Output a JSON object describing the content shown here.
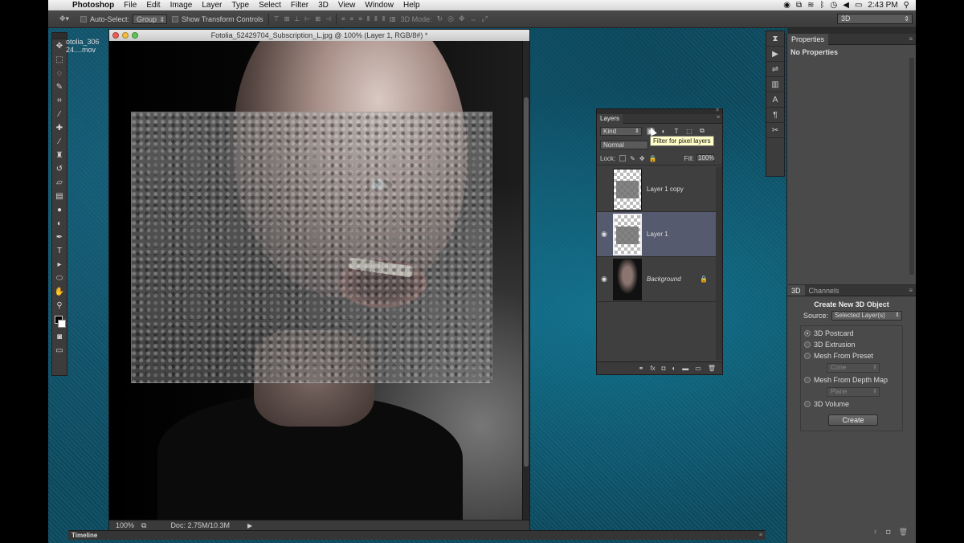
{
  "menubar": {
    "app_name": "Photoshop",
    "items": [
      "File",
      "Edit",
      "Image",
      "Layer",
      "Type",
      "Select",
      "Filter",
      "3D",
      "View",
      "Window",
      "Help"
    ],
    "clock": "2:43 PM"
  },
  "options_bar": {
    "auto_select_label": "Auto-Select:",
    "auto_select_value": "Group",
    "transform_label": "Show Transform Controls",
    "mode_3d_label": "3D Mode:",
    "workspace": "3D"
  },
  "doc_stub": {
    "line1": "otolia_306",
    "line2": "24....mov"
  },
  "document": {
    "title": "Fotolia_52429704_Subscription_L.jpg @ 100% (Layer 1, RGB/8#) *",
    "zoom": "100%",
    "doc_size": "Doc: 2.75M/10.3M"
  },
  "properties_panel": {
    "tab": "Properties",
    "empty_text": "No Properties"
  },
  "panel_3d": {
    "tabs": [
      "3D",
      "Channels"
    ],
    "heading": "Create New 3D Object",
    "source_label": "Source:",
    "source_value": "Selected Layer(s)",
    "options": [
      {
        "label": "3D Postcard",
        "selected": true
      },
      {
        "label": "3D Extrusion",
        "selected": false
      },
      {
        "label": "Mesh From Preset",
        "selected": false
      },
      {
        "label": "Mesh From Depth Map",
        "selected": false
      },
      {
        "label": "3D Volume",
        "selected": false
      }
    ],
    "preset_value": "Cone",
    "depth_map_value": "Plane",
    "create_button": "Create"
  },
  "layers_panel": {
    "tab": "Layers",
    "filter_kind": "Kind",
    "blend_mode": "Normal",
    "lock_label": "Lock:",
    "fill_label": "Fill:",
    "fill_value": "100%",
    "layers": [
      {
        "name": "Layer 1 copy",
        "visible": false,
        "selected": false
      },
      {
        "name": "Layer 1",
        "visible": true,
        "selected": true
      },
      {
        "name": "Background",
        "visible": true,
        "selected": false,
        "locked": true
      }
    ]
  },
  "tooltip": "Filter for pixel layers",
  "timeline": {
    "label": "Timeline"
  }
}
